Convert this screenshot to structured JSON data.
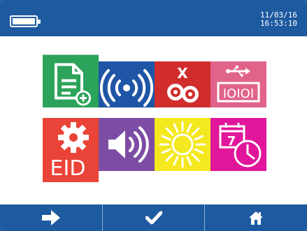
{
  "status_bar": {
    "date": "11/03/16",
    "time": "16:53:10",
    "battery_level": 1.0
  },
  "menu": {
    "tiles": [
      {
        "icon": "new-document-icon",
        "color": "#2ca35a"
      },
      {
        "icon": "wireless-signal-icon",
        "color": "#1f55a5"
      },
      {
        "icon": "delete-records-icon",
        "color": "#d12d2d",
        "label": "X"
      },
      {
        "icon": "usb-connection-icon",
        "color": "#e0638a",
        "label": "IOIOI"
      },
      {
        "icon": "eid-settings-icon",
        "color": "#ea4337",
        "label": "EID"
      },
      {
        "icon": "volume-icon",
        "color": "#7d4ca4"
      },
      {
        "icon": "brightness-icon",
        "color": "#f4e81e"
      },
      {
        "icon": "date-time-icon",
        "color": "#e1169b",
        "label": "7"
      }
    ]
  },
  "nav": [
    {
      "icon": "arrow-right-icon"
    },
    {
      "icon": "checkmark-icon"
    },
    {
      "icon": "home-icon"
    }
  ]
}
